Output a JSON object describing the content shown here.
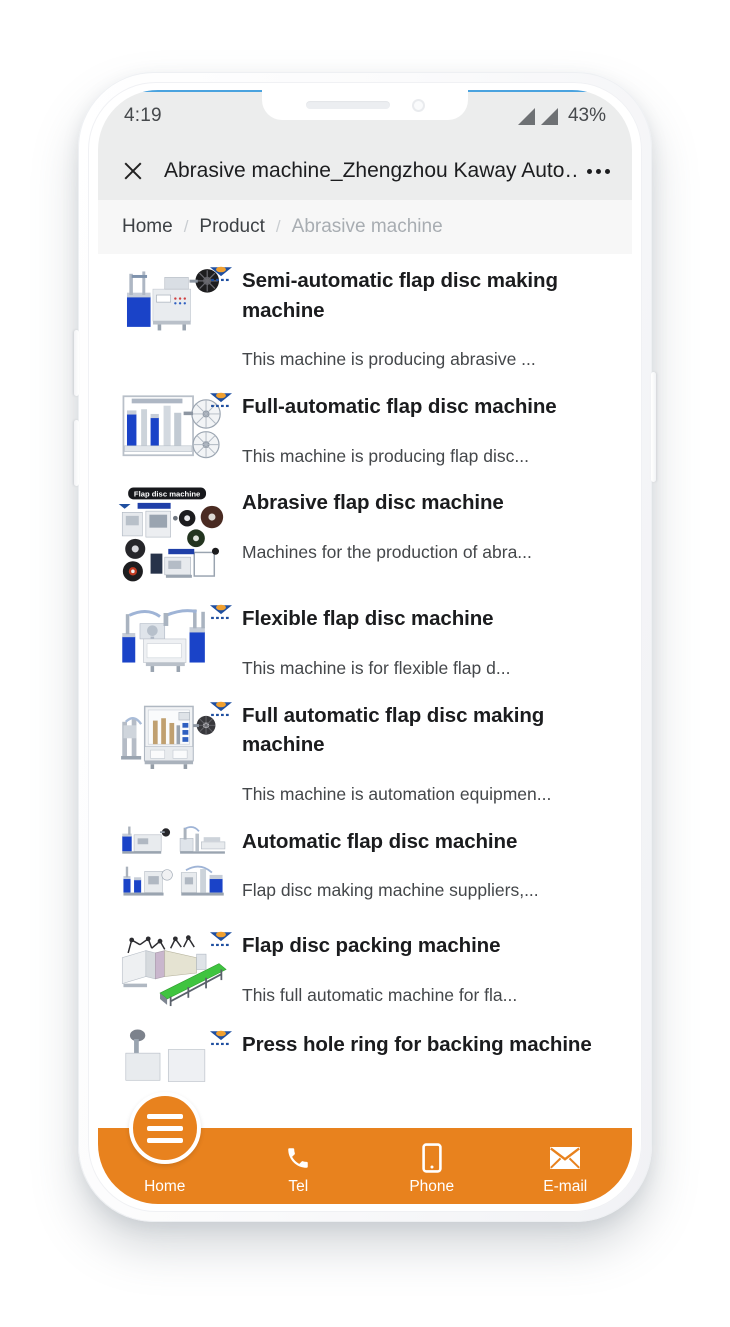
{
  "status_bar": {
    "time": "4:19",
    "battery": "43%",
    "signal_icon": "signal-triangle-icon",
    "signal_count": 2
  },
  "browser": {
    "close_icon": "close-icon",
    "title": "Abrasive machine_Zhengzhou Kaway Auto…",
    "more_icon": "more-options-icon"
  },
  "breadcrumb": {
    "items": [
      {
        "label": "Home",
        "current": false
      },
      {
        "label": "Product",
        "current": false
      },
      {
        "label": "Abrasive machine",
        "current": true
      }
    ],
    "separator": "/"
  },
  "products": [
    {
      "title": "Semi-automatic flap disc making machine",
      "desc": "This machine is producing abrasive ...",
      "image": "semi-automatic-flap-disc-making-machine-photo"
    },
    {
      "title": "Full-automatic flap disc machine",
      "desc": "This machine is producing flap disc...",
      "image": "full-automatic-flap-disc-machine-photo"
    },
    {
      "title": "Abrasive flap disc machine",
      "desc": "Machines for the production of abra...",
      "image": "abrasive-flap-disc-machine-collage",
      "banner_text": "Flap disc machine"
    },
    {
      "title": "Flexible flap disc machine",
      "desc": "This machine is for flexible flap d...",
      "image": "flexible-flap-disc-machine-photo"
    },
    {
      "title": "Full automatic flap disc making machine",
      "desc": "This machine is automation equipmen...",
      "image": "full-automatic-flap-disc-making-machine-photo"
    },
    {
      "title": "Automatic flap disc machine",
      "desc": "Flap disc making machine suppliers,...",
      "image": "automatic-flap-disc-machine-grid"
    },
    {
      "title": "Flap disc packing machine",
      "desc": "This full automatic machine for fla...",
      "image": "flap-disc-packing-machine-photo"
    },
    {
      "title": "Press hole ring for backing machine",
      "desc": "",
      "image": "press-hole-ring-backing-machine-photo"
    }
  ],
  "bottom_nav": {
    "home": {
      "label": "Home",
      "icon": "hamburger-menu-icon"
    },
    "items": [
      {
        "label": "Tel",
        "icon": "phone-handset-icon"
      },
      {
        "label": "Phone",
        "icon": "mobile-phone-icon"
      },
      {
        "label": "E-mail",
        "icon": "envelope-icon"
      }
    ]
  },
  "colors": {
    "accent": "#e8821e",
    "status_bg": "#eceded",
    "breadcrumb_bg": "#f7f7f7",
    "title_text": "#1b1c1e"
  }
}
